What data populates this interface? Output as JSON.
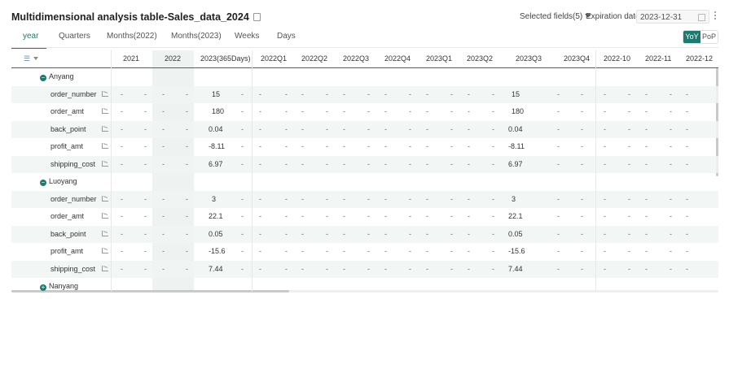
{
  "header": {
    "title": "Multidimensional analysis table-Sales_data_2024",
    "selected_fields": "Selected fields(5)",
    "expiration_label": "Expiration date",
    "expiration_date": "2023-12-31"
  },
  "tabs": [
    "year",
    "Quarters",
    "Months(2022)",
    "Months(2023)",
    "Weeks",
    "Days"
  ],
  "active_tab": "year",
  "compare_toggle": {
    "yoy": "YoY",
    "pop": "PoP",
    "selected": "YoY"
  },
  "columns": [
    "2021",
    "2022",
    "2023(365Days)",
    "2022Q1",
    "2022Q2",
    "2022Q3",
    "2022Q4",
    "2023Q1",
    "2023Q2",
    "2023Q3",
    "2023Q4",
    "2022-10",
    "2022-11",
    "2022-12"
  ],
  "groups": [
    {
      "name": "Anyang",
      "expanded": true,
      "metrics": [
        {
          "name": "order_number",
          "value_2023": "15",
          "value_2023q3": "15"
        },
        {
          "name": "order_amt",
          "value_2023": "180",
          "value_2023q3": "180"
        },
        {
          "name": "back_point",
          "value_2023": "0.04",
          "value_2023q3": "0.04"
        },
        {
          "name": "profit_amt",
          "value_2023": "-8.11",
          "value_2023q3": "-8.11"
        },
        {
          "name": "shipping_cost",
          "value_2023": "6.97",
          "value_2023q3": "6.97"
        }
      ]
    },
    {
      "name": "Luoyang",
      "expanded": true,
      "metrics": [
        {
          "name": "order_number",
          "value_2023": "3",
          "value_2023q3": "3"
        },
        {
          "name": "order_amt",
          "value_2023": "22.1",
          "value_2023q3": "22.1"
        },
        {
          "name": "back_point",
          "value_2023": "0.05",
          "value_2023q3": "0.05"
        },
        {
          "name": "profit_amt",
          "value_2023": "-15.6",
          "value_2023q3": "-15.6"
        },
        {
          "name": "shipping_cost",
          "value_2023": "7.44",
          "value_2023q3": "7.44"
        }
      ]
    },
    {
      "name": "Nanyang",
      "expanded": false,
      "metrics": []
    }
  ],
  "empty_value": "-",
  "colors": {
    "accent": "#1a7b6e",
    "highlight_column": "#eef3f1"
  }
}
